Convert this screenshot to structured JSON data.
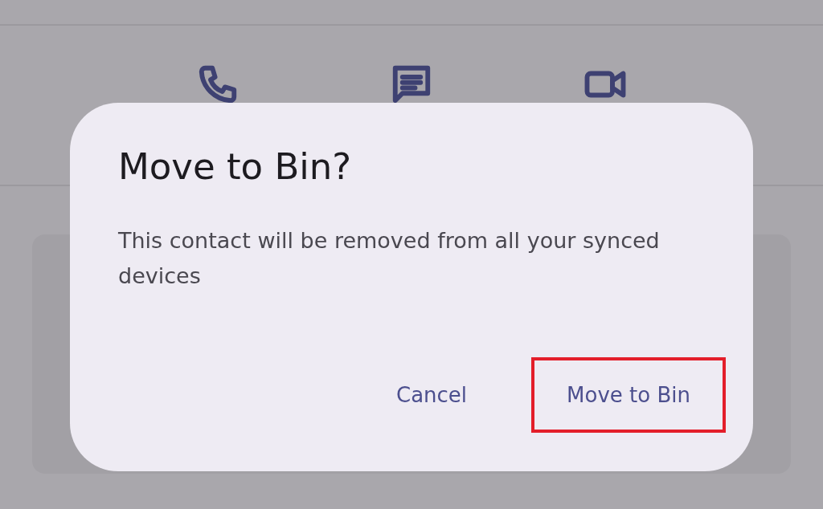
{
  "background": {
    "actions": [
      {
        "kind": "call"
      },
      {
        "kind": "message"
      },
      {
        "kind": "video"
      }
    ]
  },
  "dialog": {
    "title": "Move to Bin?",
    "message": "This contact will be removed from all your synced devices",
    "buttons": [
      {
        "label": "Cancel",
        "highlighted": false
      },
      {
        "label": "Move to Bin",
        "highlighted": true
      }
    ]
  }
}
